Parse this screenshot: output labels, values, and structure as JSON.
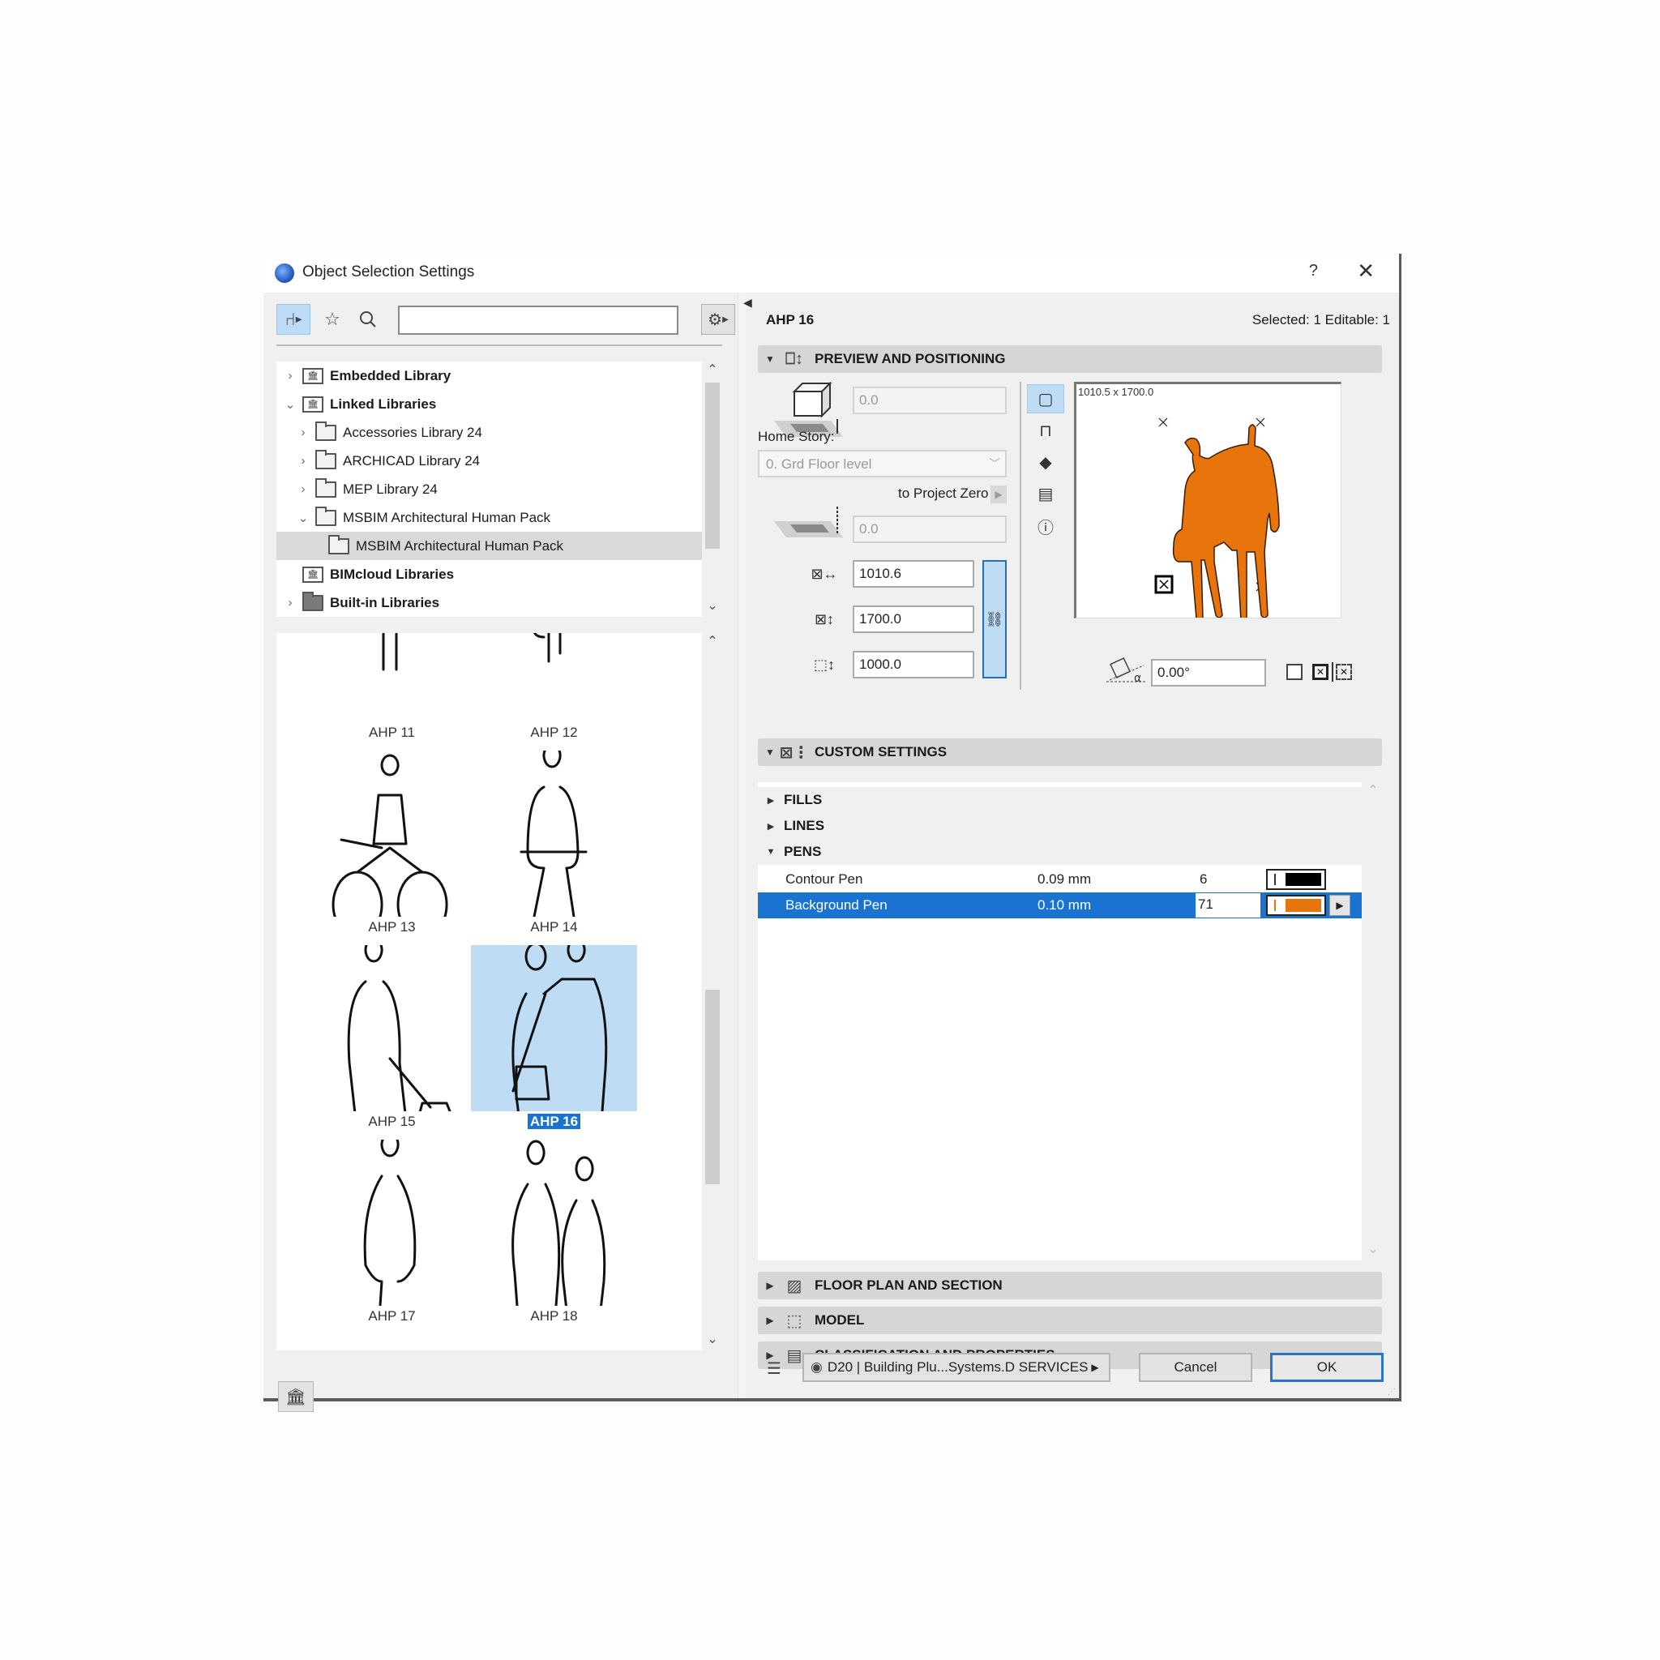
{
  "window": {
    "title": "Object Selection Settings",
    "help_label": "?",
    "close_label": "✕"
  },
  "left": {
    "toolbar": {
      "object_browser_icon": "chair-icon",
      "favorites_icon": "star-icon",
      "search_icon": "search-icon",
      "search_value": "",
      "search_placeholder": "",
      "settings_icon": "gear-icon"
    },
    "tree": [
      {
        "label": "Embedded Library",
        "bold": true,
        "expander": "collapsed",
        "icon": "library-doc-icon",
        "indent": 0
      },
      {
        "label": "Linked Libraries",
        "bold": true,
        "expander": "expanded",
        "icon": "library-folder-icon",
        "indent": 0
      },
      {
        "label": "Accessories Library 24",
        "bold": false,
        "expander": "collapsed",
        "icon": "folder-icon",
        "indent": 1
      },
      {
        "label": "ARCHICAD Library 24",
        "bold": false,
        "expander": "collapsed",
        "icon": "folder-icon",
        "indent": 1
      },
      {
        "label": "MEP Library 24",
        "bold": false,
        "expander": "collapsed",
        "icon": "folder-icon",
        "indent": 1
      },
      {
        "label": "MSBIM Architectural Human Pack",
        "bold": false,
        "expander": "expanded",
        "icon": "folder-icon",
        "indent": 1
      },
      {
        "label": "MSBIM Architectural Human Pack",
        "bold": false,
        "expander": "none",
        "icon": "folder-icon",
        "indent": 2,
        "selected": true
      },
      {
        "label": "BIMcloud Libraries",
        "bold": true,
        "expander": "none",
        "icon": "bimcloud-icon",
        "indent": 0
      },
      {
        "label": "Built-in Libraries",
        "bold": true,
        "expander": "collapsed",
        "icon": "folder-dark-icon",
        "indent": 0
      }
    ],
    "gallery": [
      {
        "label": "AHP 11"
      },
      {
        "label": "AHP 12"
      },
      {
        "label": "AHP 13"
      },
      {
        "label": "AHP 14"
      },
      {
        "label": "AHP 15"
      },
      {
        "label": "AHP 16",
        "selected": true
      },
      {
        "label": "AHP 17"
      },
      {
        "label": "AHP 18"
      }
    ],
    "library_manager_icon": "library-manager-icon"
  },
  "right": {
    "object_name": "AHP 16",
    "selection_info": "Selected: 1 Editable: 1",
    "preview_positioning": {
      "title": "PREVIEW AND POSITIONING",
      "elevation_value": "0.0",
      "home_story_label": "Home Story:",
      "home_story_value": "0. Grd Floor level",
      "to_project_zero_label": "to Project Zero",
      "project_zero_value": "0.0",
      "width_value": "1010.6",
      "depth_value": "1700.0",
      "height_value": "1000.0",
      "preview_dims": "1010.5 x 1700.0",
      "rotation_value": "0.00°",
      "preview_fill_color": "#e8740c"
    },
    "custom_settings": {
      "title": "CUSTOM SETTINGS",
      "groups": [
        {
          "label": "FILLS",
          "state": "collapsed"
        },
        {
          "label": "LINES",
          "state": "collapsed"
        },
        {
          "label": "PENS",
          "state": "expanded"
        }
      ],
      "pens": [
        {
          "name": "Contour Pen",
          "width": "0.09 mm",
          "number": "6",
          "color": "#000000"
        },
        {
          "name": "Background Pen",
          "width": "0.10 mm",
          "number": "71",
          "color": "#e8740c",
          "selected": true
        }
      ]
    },
    "collapsed_panels": [
      {
        "title": "FLOOR PLAN AND SECTION",
        "icon": "floor-plan-icon"
      },
      {
        "title": "MODEL",
        "icon": "model-icon"
      },
      {
        "title": "CLASSIFICATION AND PROPERTIES",
        "icon": "classification-icon"
      }
    ],
    "footer": {
      "layer_value": "D20 | Building Plu...Systems.D SERVICES",
      "cancel_label": "Cancel",
      "ok_label": "OK"
    }
  },
  "colors": {
    "accent": "#1a73d1",
    "selection_light": "#bfdcf5",
    "pen_orange": "#e8740c"
  }
}
